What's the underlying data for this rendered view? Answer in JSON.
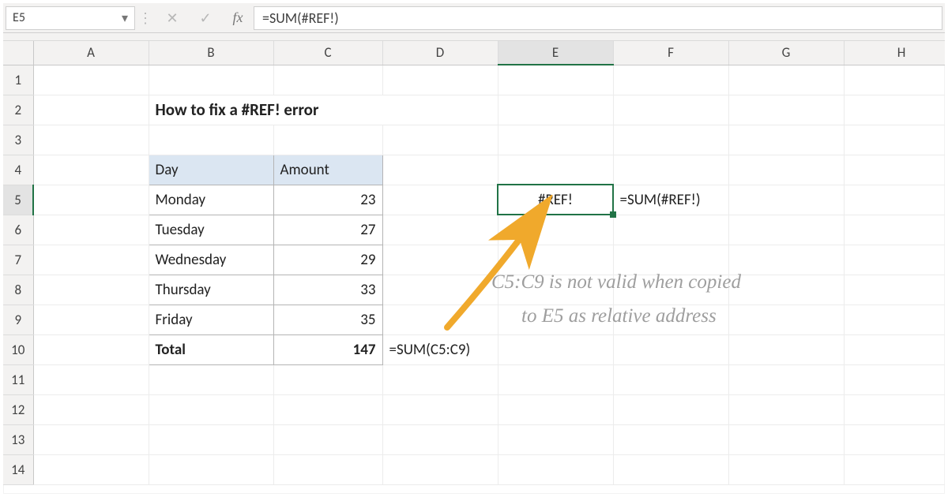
{
  "active_cell_ref": "E5",
  "formula": "=SUM(#REF!)",
  "columns": [
    "A",
    "B",
    "C",
    "D",
    "E",
    "F",
    "G",
    "H"
  ],
  "rows": [
    "1",
    "2",
    "3",
    "4",
    "5",
    "6",
    "7",
    "8",
    "9",
    "10",
    "11",
    "12",
    "13",
    "14"
  ],
  "title": "How to fix a #REF! error",
  "table": {
    "headers": {
      "day": "Day",
      "amount": "Amount"
    },
    "rows": [
      {
        "day": "Monday",
        "amount": "23"
      },
      {
        "day": "Tuesday",
        "amount": "27"
      },
      {
        "day": "Wednesday",
        "amount": "29"
      },
      {
        "day": "Thursday",
        "amount": "33"
      },
      {
        "day": "Friday",
        "amount": "35"
      }
    ],
    "total_label": "Total",
    "total_value": "147"
  },
  "active_cell_value": "#REF!",
  "annotations": {
    "e5_formula": "=SUM(#REF!)",
    "c10_formula": "=SUM(C5:C9)",
    "handwriting_line1": "C5:C9 is not valid when copied",
    "handwriting_line2": "to E5 as relative address"
  },
  "icons": {
    "dropdown": "▾",
    "sep": "⋮",
    "cancel": "✕",
    "accept": "✓",
    "fx": "fx"
  }
}
